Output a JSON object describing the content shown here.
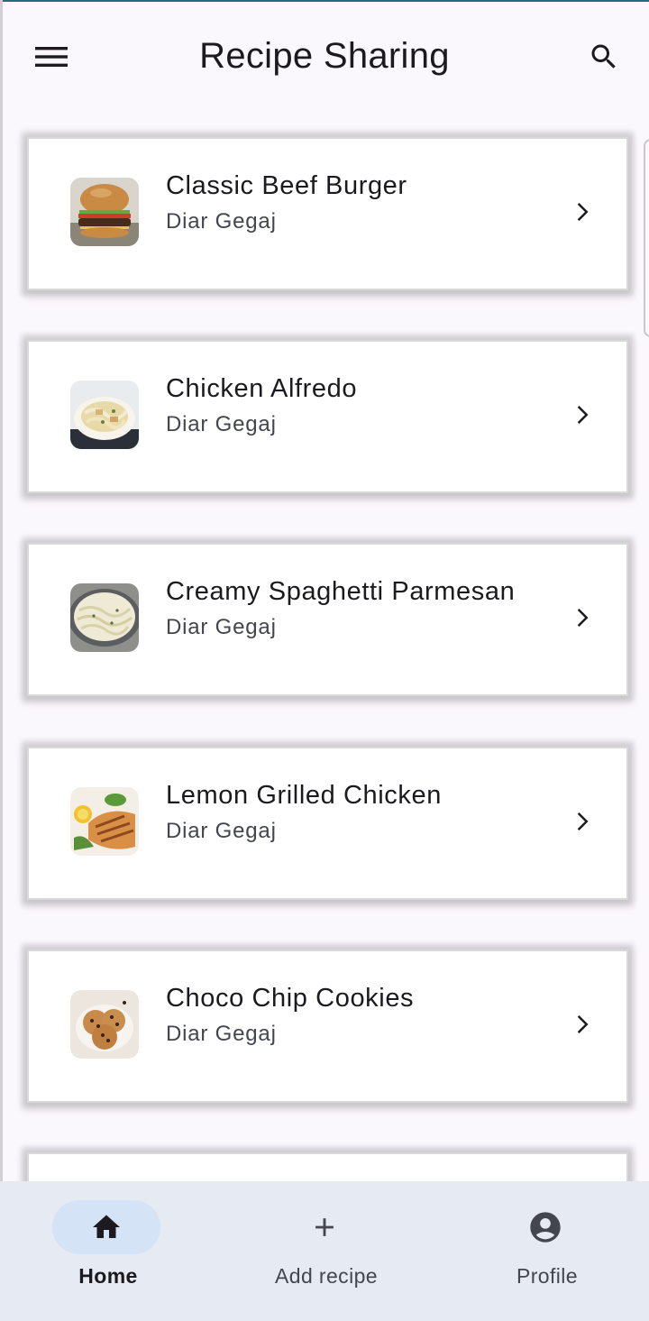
{
  "app": {
    "title": "Recipe Sharing",
    "icons": {
      "menu": "menu-icon",
      "search": "search-icon"
    }
  },
  "recipes": [
    {
      "title": "Classic Beef Burger",
      "author": "Diar Gegaj",
      "image": "burger"
    },
    {
      "title": "Chicken Alfredo",
      "author": "Diar Gegaj",
      "image": "alfredo"
    },
    {
      "title": "Creamy Spaghetti Parmesan",
      "author": "Diar Gegaj",
      "image": "spaghetti"
    },
    {
      "title": "Lemon Grilled Chicken",
      "author": "Diar Gegaj",
      "image": "grilled-chicken"
    },
    {
      "title": "Choco Chip Cookies",
      "author": "Diar Gegaj",
      "image": "cookies"
    }
  ],
  "nav": {
    "items": [
      {
        "label": "Home",
        "icon": "home-icon",
        "active": true
      },
      {
        "label": "Add recipe",
        "icon": "plus-icon",
        "active": false
      },
      {
        "label": "Profile",
        "icon": "account-circle-icon",
        "active": false
      }
    ]
  },
  "colors": {
    "background": "#fbf8fd",
    "card": "#ffffff",
    "nav_bar": "#e6eaf2",
    "nav_active_pill": "#d4e3f5",
    "text_primary": "#1b1b1f",
    "text_secondary": "#44464f"
  }
}
